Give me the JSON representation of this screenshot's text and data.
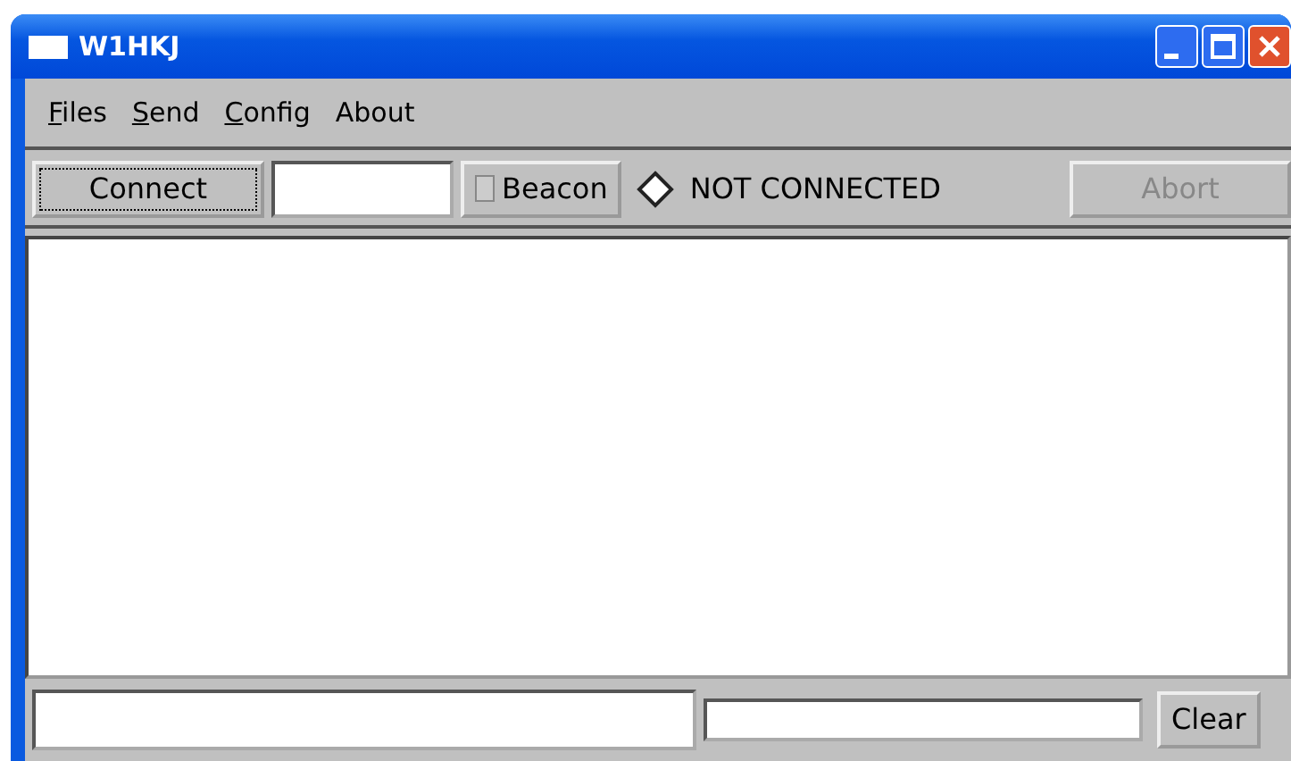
{
  "window": {
    "title": "W1HKJ"
  },
  "menu": [
    {
      "label": "Files",
      "underline_first": true
    },
    {
      "label": "Send",
      "underline_first": true
    },
    {
      "label": "Config",
      "underline_first": true
    },
    {
      "label": "About",
      "underline_first": false
    }
  ],
  "toolbar": {
    "connect": {
      "label": "Connect",
      "focused": true
    },
    "beacon": {
      "label": "Beacon",
      "checked": false
    },
    "status": {
      "text": "NOT CONNECTED",
      "connected": false
    },
    "abort": {
      "label": "Abort",
      "disabled": true
    }
  },
  "bottom": {
    "clear": {
      "label": "Clear"
    }
  }
}
